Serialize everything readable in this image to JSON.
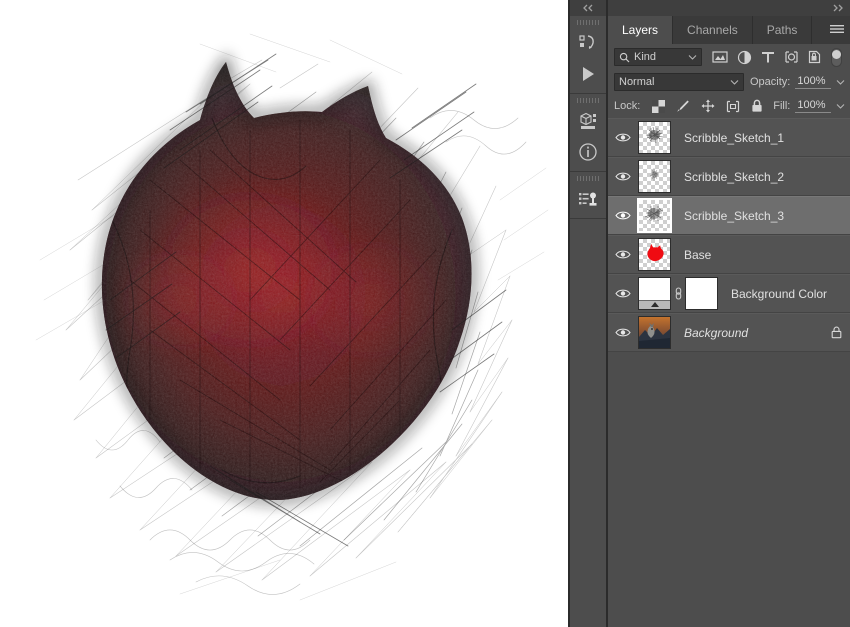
{
  "application": "Adobe Photoshop",
  "canvas": {
    "artwork_title": "Scribbled sketch of a red wolf head",
    "background_color": "#ffffff",
    "primary_color": "#6b0d12",
    "sketch_color": "#2a2a2a"
  },
  "icon_rail": {
    "collapse_icon": "chevron-double-left-icon",
    "groups": [
      {
        "grip": "panel-grip",
        "buttons": [
          {
            "icon": "history-icon",
            "label": "History"
          },
          {
            "icon": "play-icon",
            "label": "Actions"
          }
        ]
      },
      {
        "grip": "panel-grip",
        "buttons": [
          {
            "icon": "3d-cube-icon",
            "label": "3D"
          },
          {
            "icon": "info-circle-icon",
            "label": "Info"
          }
        ]
      },
      {
        "grip": "panel-grip",
        "buttons": [
          {
            "icon": "clone-source-icon",
            "label": "Clone Source"
          }
        ]
      }
    ]
  },
  "panel": {
    "expand_icon": "chevron-double-right-icon",
    "menu_icon": "hamburger-menu-icon",
    "tabs": [
      {
        "label": "Layers",
        "active": true
      },
      {
        "label": "Channels",
        "active": false
      },
      {
        "label": "Paths",
        "active": false
      }
    ],
    "filter": {
      "search_icon": "magnifier-icon",
      "kind_label": "Kind",
      "chevron_icon": "chevron-down-icon",
      "type_filters": [
        {
          "icon": "pixel-layer-filter-icon",
          "label": "Filter for pixel layers"
        },
        {
          "icon": "adjustment-layer-filter-icon",
          "label": "Filter for adjustment layers"
        },
        {
          "icon": "type-layer-filter-icon",
          "label": "Filter for type layers"
        },
        {
          "icon": "shape-layer-filter-icon",
          "label": "Filter for shape layers"
        },
        {
          "icon": "smart-object-filter-icon",
          "label": "Filter for smart objects"
        }
      ],
      "toggle_icon": "filter-toggle-switch"
    },
    "blend": {
      "mode": "Normal",
      "mode_chevron_icon": "chevron-down-icon",
      "opacity_label": "Opacity:",
      "opacity_value": "100%",
      "opacity_chevron_icon": "chevron-down-icon"
    },
    "lock": {
      "label": "Lock:",
      "icons": [
        {
          "icon": "lock-transparency-icon",
          "label": "Lock transparent pixels"
        },
        {
          "icon": "lock-image-brush-icon",
          "label": "Lock image pixels"
        },
        {
          "icon": "lock-position-move-icon",
          "label": "Lock position"
        },
        {
          "icon": "lock-artboard-icon",
          "label": "Prevent auto-nesting"
        },
        {
          "icon": "lock-all-padlock-icon",
          "label": "Lock all"
        }
      ],
      "fill_label": "Fill:",
      "fill_value": "100%",
      "fill_chevron_icon": "chevron-down-icon"
    },
    "layers": [
      {
        "name": "Scribble_Sketch_1",
        "visible": true,
        "selected": false,
        "italic": false,
        "thumb_type": "transparent-sketch",
        "thumb_framed": false,
        "locked": false,
        "has_mask": false,
        "eye_icon": "eye-icon"
      },
      {
        "name": "Scribble_Sketch_2",
        "visible": true,
        "selected": false,
        "italic": false,
        "thumb_type": "transparent-sketch",
        "thumb_framed": false,
        "locked": false,
        "has_mask": false,
        "eye_icon": "eye-icon"
      },
      {
        "name": "Scribble_Sketch_3",
        "visible": true,
        "selected": true,
        "italic": false,
        "thumb_type": "transparent-sketch",
        "thumb_framed": true,
        "locked": false,
        "has_mask": false,
        "eye_icon": "eye-icon"
      },
      {
        "name": "Base",
        "visible": true,
        "selected": false,
        "italic": false,
        "thumb_type": "red-shape",
        "thumb_framed": false,
        "locked": false,
        "has_mask": false,
        "eye_icon": "eye-icon"
      },
      {
        "name": "Background Color",
        "visible": true,
        "selected": false,
        "italic": false,
        "thumb_type": "fill-with-mask",
        "thumb_framed": false,
        "locked": false,
        "has_mask": true,
        "link_icon": "link-chain-icon",
        "eye_icon": "eye-icon"
      },
      {
        "name": "Background",
        "visible": true,
        "selected": false,
        "italic": true,
        "thumb_type": "photo",
        "thumb_framed": false,
        "locked": true,
        "lock_icon": "padlock-icon",
        "has_mask": false,
        "eye_icon": "eye-icon"
      }
    ]
  }
}
